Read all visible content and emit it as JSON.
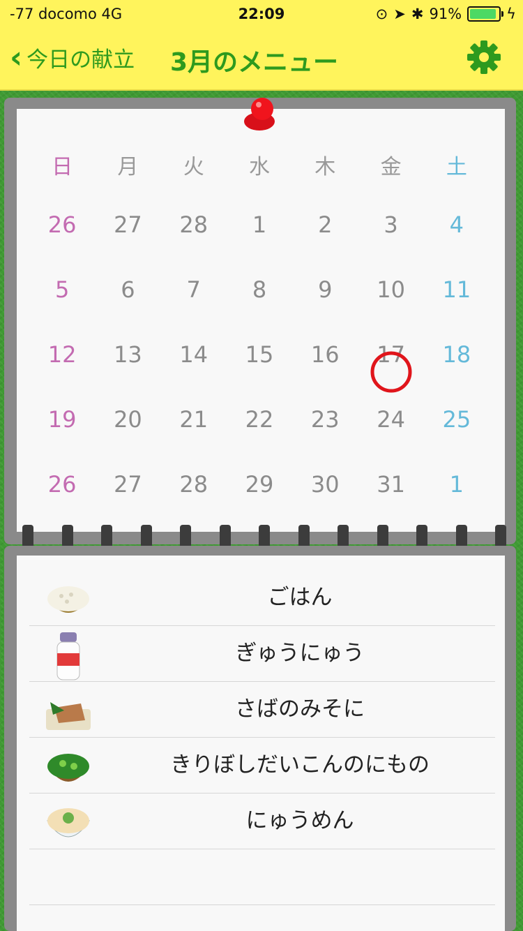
{
  "status_bar": {
    "carrier": "-77 docomo   4G",
    "time": "22:09",
    "battery_text": "91%",
    "battery_level": 0.91
  },
  "nav": {
    "back_label": "今日の献立",
    "title": "3月のメニュー",
    "settings_icon": "gear-icon"
  },
  "calendar": {
    "weekdays": [
      "日",
      "月",
      "火",
      "水",
      "木",
      "金",
      "土"
    ],
    "weeks": [
      [
        "26",
        "27",
        "28",
        "1",
        "2",
        "3",
        "4"
      ],
      [
        "5",
        "6",
        "7",
        "8",
        "9",
        "10",
        "11"
      ],
      [
        "12",
        "13",
        "14",
        "15",
        "16",
        "17",
        "18"
      ],
      [
        "19",
        "20",
        "21",
        "22",
        "23",
        "24",
        "25"
      ],
      [
        "26",
        "27",
        "28",
        "29",
        "30",
        "31",
        "1"
      ]
    ],
    "highlighted_day": "17"
  },
  "menu": {
    "items": [
      {
        "label": "ごはん",
        "icon": "rice-bowl-icon"
      },
      {
        "label": "ぎゅうにゅう",
        "icon": "milk-bottle-icon"
      },
      {
        "label": "さばのみそに",
        "icon": "fish-dish-icon"
      },
      {
        "label": "きりぼしだいこんのにもの",
        "icon": "vegetable-bowl-icon"
      },
      {
        "label": "にゅうめん",
        "icon": "noodle-bowl-icon"
      }
    ]
  },
  "colors": {
    "header_bg": "#fff45c",
    "accent_green": "#2e9a1e",
    "sunday": "#c36bb1",
    "saturday": "#64b9d9",
    "highlight_red": "#e0151b"
  }
}
